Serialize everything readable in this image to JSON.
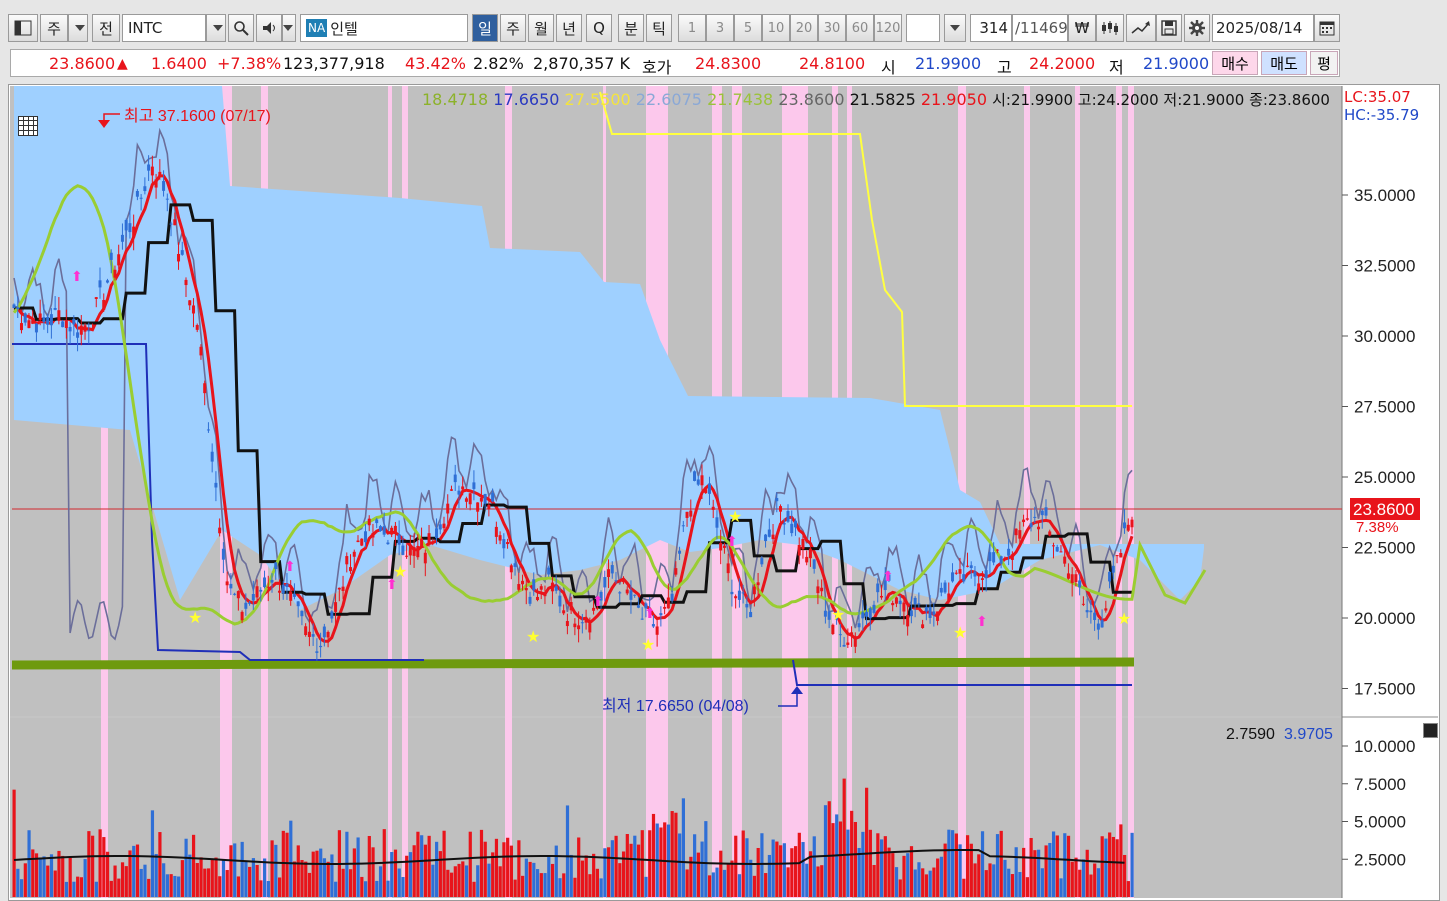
{
  "toolbar": {
    "ju_label": "주",
    "jeon_label": "전",
    "symbol": "INTC",
    "na_badge": "NA",
    "stock_name": "인텔",
    "periods": [
      "일",
      "주",
      "월",
      "년",
      "Q",
      "분",
      "틱"
    ],
    "minute_options": [
      "1",
      "3",
      "5",
      "10",
      "20",
      "30",
      "60",
      "120"
    ],
    "count_value": "314",
    "count_total": "/11469",
    "won_symbol": "₩",
    "date": "2025/08/14"
  },
  "quote": {
    "price": "23.8600",
    "up_arrow": "▲",
    "change": "1.6400",
    "change_pct": "+7.38%",
    "volume": "123,377,918",
    "vol_ratio": "43.42%",
    "turnover": "2.82%",
    "amount": "2,870,357 K",
    "hoga_label": "호가",
    "ask": "24.8300",
    "bid": "24.8100",
    "open_label": "시",
    "open": "21.9900",
    "high_label": "고",
    "high": "24.2000",
    "low_label": "저",
    "low": "21.9000",
    "buy_label": "매수",
    "sell_label": "매도",
    "eval_label": "평"
  },
  "indicators": {
    "v1": "18.4718",
    "v2": "17.6650",
    "v3": "27.5500",
    "v4": "22.6075",
    "v5": "21.7438",
    "v6": "23.8600",
    "v7": "21.5825",
    "v8": "21.9050",
    "ohlc_text": "시:21.9900 고:24.2000 저:21.9000 종:23.8600",
    "lc": "LC:35.07",
    "hc": "HC:-35.79"
  },
  "annotations": {
    "high_marker": "최고 37.1600 (07/17)",
    "low_marker": "최저 17.6650 (04/08)",
    "price_tag": "23.8600",
    "price_pct": "7.38%",
    "vol_value1": "2.7590",
    "vol_value2": "3.9705"
  },
  "colors": {
    "up": "#e8141b",
    "down": "#2f6fd6",
    "cloud": "#9fd0ff",
    "highlight": "#ffc8ee",
    "yellow_line": "#ffff40",
    "green_line": "#9acd32",
    "thick_green": "#6e9a0e"
  },
  "chart_data": {
    "type": "line",
    "title": "INTC",
    "price_axis": {
      "ticks": [
        "35.0000",
        "32.5000",
        "30.0000",
        "27.5000",
        "25.0000",
        "22.5000",
        "20.0000",
        "17.5000"
      ],
      "ylim": [
        16.5,
        37.5
      ]
    },
    "volume_axis": {
      "ticks": [
        "10.0000",
        "7.5000",
        "5.0000",
        "2.5000"
      ],
      "ylim": [
        0,
        11
      ]
    },
    "period_high": 37.16,
    "period_low": 17.665,
    "last_close": 23.86,
    "series": [
      {
        "name": "close",
        "values": [
          31.0,
          30.6,
          30.4,
          30.8,
          30.2,
          30.5,
          31.8,
          33.2,
          34.4,
          36.2,
          35.0,
          32.5,
          30.4,
          25.5,
          21.0,
          20.3,
          20.9,
          21.6,
          20.7,
          19.5,
          19.1,
          20.4,
          22.3,
          23.1,
          23.0,
          22.9,
          22.3,
          22.6,
          23.7,
          24.7,
          24.6,
          24.2,
          22.9,
          21.5,
          20.7,
          21.2,
          20.3,
          20.1,
          20.3,
          21.6,
          20.9,
          20.0,
          19.7,
          20.6,
          24.0,
          25.0,
          23.0,
          21.0,
          20.1,
          22.6,
          24.0,
          23.1,
          22.1,
          20.3,
          19.3,
          19.6,
          20.5,
          21.0,
          20.7,
          20.2,
          20.2,
          21.1,
          21.4,
          21.6,
          21.9,
          22.4,
          23.3,
          23.6,
          22.6,
          21.8,
          20.2,
          19.9,
          21.8,
          23.86
        ]
      }
    ]
  }
}
